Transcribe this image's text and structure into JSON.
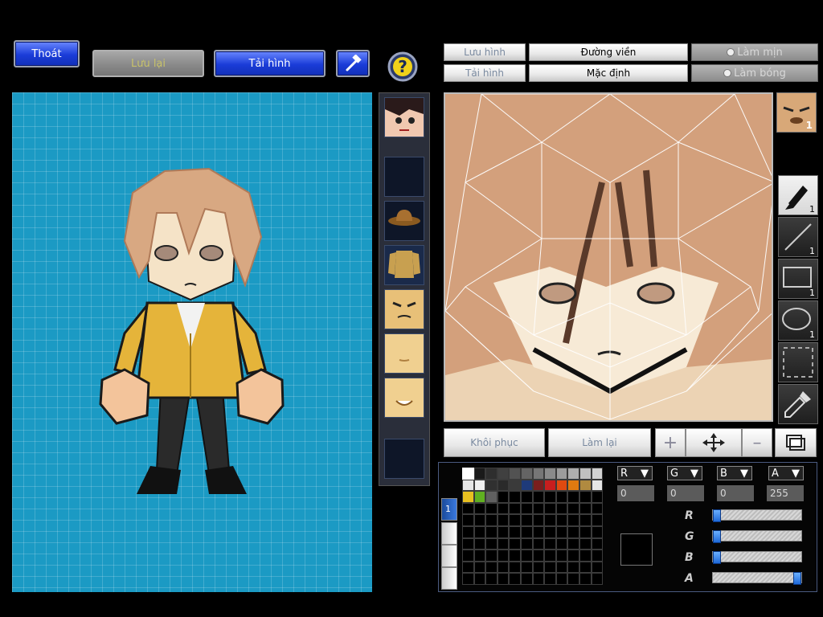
{
  "toolbar": {
    "exit_label": "Thoát",
    "save_label": "Lưu lại",
    "reload_label": "Tải hình",
    "help_icon": "question-icon",
    "hammer_icon": "hammer-icon"
  },
  "editor_toolbar": {
    "save_image": "Lưu hình",
    "load_image": "Tải hình",
    "outline": "Đường viền",
    "default": "Mặc định",
    "smooth": "Làm mịn",
    "shine": "Làm bóng"
  },
  "editor_actions": {
    "restore": "Khôi phục",
    "redo": "Làm lại"
  },
  "preview": {
    "count": "1"
  },
  "tools": [
    {
      "name": "pen-tool",
      "count": "1"
    },
    {
      "name": "line-tool",
      "count": "1"
    },
    {
      "name": "rect-tool",
      "count": "1"
    },
    {
      "name": "ellipse-tool",
      "count": "1"
    },
    {
      "name": "select-tool",
      "count": ""
    },
    {
      "name": "eyedropper-tool",
      "count": ""
    }
  ],
  "color": {
    "channels": [
      {
        "label": "R",
        "value": "0"
      },
      {
        "label": "G",
        "value": "0"
      },
      {
        "label": "B",
        "value": "0"
      },
      {
        "label": "A",
        "value": "255"
      }
    ],
    "sliders": [
      {
        "label": "R",
        "level": 0
      },
      {
        "label": "G",
        "level": 0
      },
      {
        "label": "B",
        "level": 0
      },
      {
        "label": "A",
        "level": 1
      }
    ],
    "palette_row1": [
      "#ffffff",
      "#1a1a1a",
      "#2e2e2e",
      "#404040",
      "#525252",
      "#646464",
      "#767676",
      "#8a8a8a",
      "#9c9c9c",
      "#aeaeae",
      "#c0c0c0",
      "#d2d2d2"
    ],
    "palette_row2": [
      "#e6e6e6",
      "#f0f0f0",
      "#303030",
      "#2a2a2a",
      "#3a3a3a",
      "#1e3a7a",
      "#7a1e1e",
      "#c81e1e",
      "#e04a10",
      "#e07a10",
      "#b08a40",
      "#e6e6e6"
    ],
    "palette_row3": [
      "#e8c020",
      "#60b020",
      "#606060"
    ],
    "layer_index": "1"
  }
}
